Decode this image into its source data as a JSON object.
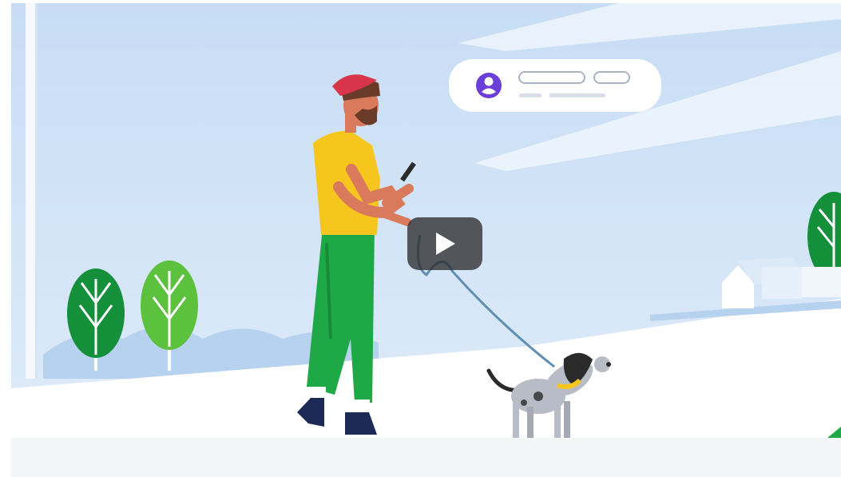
{
  "video": {
    "player": "embedded-video-thumbnail",
    "state": "paused",
    "play_icon": "play-icon"
  },
  "illustration": {
    "subject": "man-walking-dog-with-phone",
    "notification_icon": "user-avatar-icon"
  },
  "colors": {
    "sky": "#cfe2f7",
    "ground": "#ffffff",
    "shirt": "#f7c61e",
    "pants": "#1fa846",
    "cap": "#d8354a",
    "tree_dark": "#148f3a",
    "tree_light": "#5cc23e",
    "avatar": "#6b3ed8",
    "player_overlay": "#2d2d2d"
  }
}
